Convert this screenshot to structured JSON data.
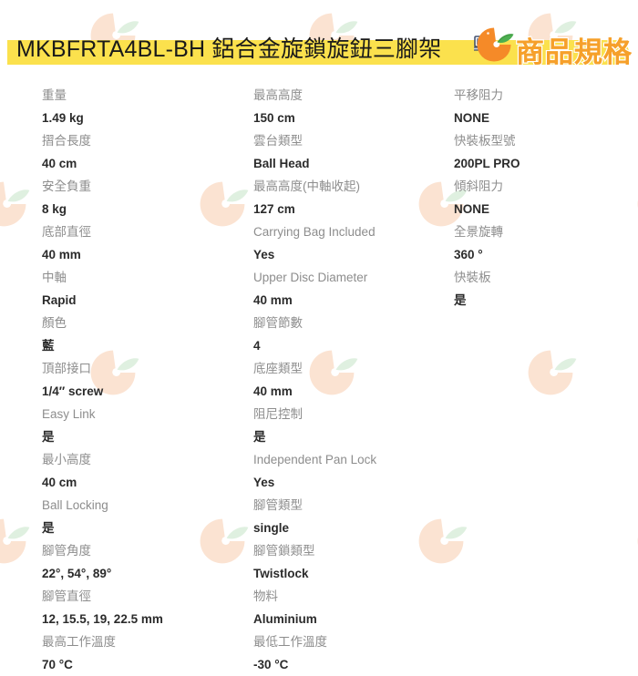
{
  "header": {
    "title": "MKBFRTA4BL-BH 鋁合金旋鎖旋鈕三腳架",
    "brand_badge_text": "商品規格",
    "logo_icon": "orange-fruit-leaf-logo",
    "bar_color": "#fbe14d",
    "brand_color": "#f6a02a"
  },
  "watermark": {
    "icon": "orange-fruit-leaf-watermark",
    "orange_color": "#fbe3d2",
    "leaf_color": "#dff0e0"
  },
  "spec_columns": [
    {
      "column_id": "column-1",
      "rows": [
        {
          "label": "重量",
          "value": "1.49 kg"
        },
        {
          "label": "摺合長度",
          "value": "40 cm"
        },
        {
          "label": "安全負重",
          "value": "8 kg"
        },
        {
          "label": "底部直徑",
          "value": "40 mm"
        },
        {
          "label": "中軸",
          "value": "Rapid"
        },
        {
          "label": "顏色",
          "value": "藍"
        },
        {
          "label": "頂部接口",
          "value": "1/4″ screw"
        },
        {
          "label": "Easy Link",
          "value": "是"
        },
        {
          "label": "最小高度",
          "value": "40 cm"
        },
        {
          "label": "Ball Locking",
          "value": "是"
        },
        {
          "label": "腳管角度",
          "value": "22°, 54°, 89°"
        },
        {
          "label": "腳管直徑",
          "value": "12, 15.5, 19, 22.5 mm"
        },
        {
          "label": "最高工作溫度",
          "value": "70 °C"
        }
      ]
    },
    {
      "column_id": "column-2",
      "rows": [
        {
          "label": "最高高度",
          "value": "150 cm"
        },
        {
          "label": "雲台類型",
          "value": "Ball Head"
        },
        {
          "label": "最高高度(中軸收起)",
          "value": "127 cm"
        },
        {
          "label": "Carrying Bag Included",
          "value": "Yes"
        },
        {
          "label": "Upper Disc Diameter",
          "value": "40 mm"
        },
        {
          "label": "腳管節數",
          "value": "4"
        },
        {
          "label": "底座類型",
          "value": "40 mm"
        },
        {
          "label": "阻尼控制",
          "value": "是"
        },
        {
          "label": "Independent Pan Lock",
          "value": "Yes"
        },
        {
          "label": "腳管類型",
          "value": "single"
        },
        {
          "label": "腳管鎖類型",
          "value": "Twistlock"
        },
        {
          "label": "物料",
          "value": "Aluminium"
        },
        {
          "label": "最低工作溫度",
          "value": "-30 °C"
        }
      ]
    },
    {
      "column_id": "column-3",
      "rows": [
        {
          "label": "平移阻力",
          "value": "NONE"
        },
        {
          "label": "快裝板型號",
          "value": "200PL PRO"
        },
        {
          "label": "傾斜阻力",
          "value": "NONE"
        },
        {
          "label": "全景旋轉",
          "value": "360 °"
        },
        {
          "label": "快裝板",
          "value": "是"
        }
      ]
    }
  ]
}
